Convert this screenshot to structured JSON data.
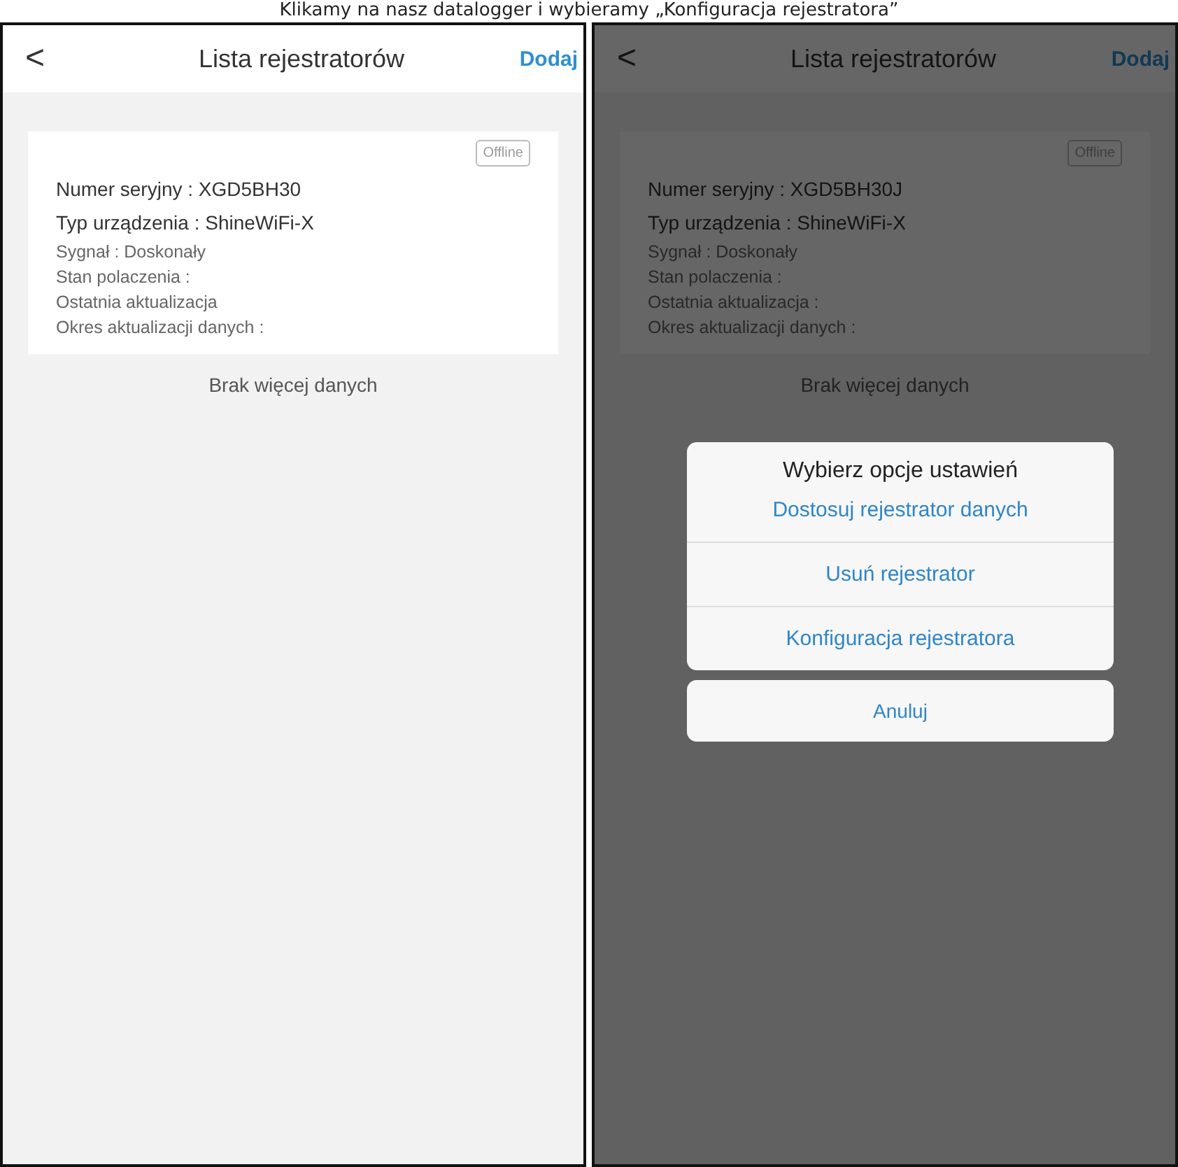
{
  "caption": "Klikamy na nasz datalogger i wybieramy „Konfiguracja rejestratora”",
  "screens": [
    {
      "dimmed": false,
      "header": {
        "back": "<",
        "title": "Lista rejestratorów",
        "action": "Dodaj"
      },
      "card": {
        "status": "Offline",
        "fields": [
          {
            "kind": "primary",
            "text": "Numer seryjny : XGD5BH30"
          },
          {
            "kind": "primary",
            "text": "Typ urządzenia : ShineWiFi-X"
          },
          {
            "kind": "secondary",
            "text": "Sygnał : Doskonały"
          },
          {
            "kind": "secondary",
            "text": "Stan polaczenia :"
          },
          {
            "kind": "secondary",
            "text": "Ostatnia aktualizacja"
          },
          {
            "kind": "secondary",
            "text": "Okres aktualizacji danych :"
          }
        ]
      },
      "footer_note": "Brak więcej danych"
    },
    {
      "dimmed": true,
      "header": {
        "back": "<",
        "title": "Lista rejestratorów",
        "action": "Dodaj"
      },
      "card": {
        "status": "Offline",
        "fields": [
          {
            "kind": "primary",
            "text": "Numer seryjny : XGD5BH30J"
          },
          {
            "kind": "primary",
            "text": "Typ urządzenia : ShineWiFi-X"
          },
          {
            "kind": "secondary",
            "text": "Sygnał : Doskonały"
          },
          {
            "kind": "secondary",
            "text": "Stan polaczenia :"
          },
          {
            "kind": "secondary",
            "text": "Ostatnia aktualizacja :"
          },
          {
            "kind": "secondary",
            "text": "Okres aktualizacji danych :"
          }
        ]
      },
      "footer_note": "Brak więcej danych",
      "dialog": {
        "title": "Wybierz opcje ustawień",
        "options": [
          "Dostosuj rejestrator danych",
          "Usuń rejestrator",
          "Konfiguracja rejestratora"
        ],
        "cancel": "Anuluj"
      }
    }
  ]
}
